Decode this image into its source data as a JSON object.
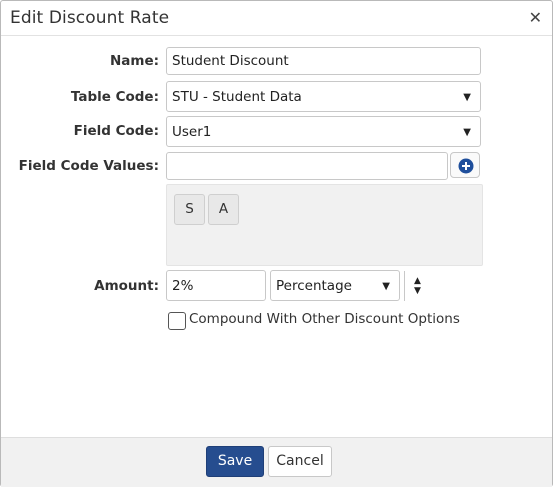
{
  "dialog": {
    "title": "Edit Discount Rate",
    "close_glyph": "✕"
  },
  "form": {
    "name": {
      "label": "Name:",
      "value": "Student Discount"
    },
    "table_code": {
      "label": "Table Code:",
      "value": "STU - Student Data"
    },
    "field_code": {
      "label": "Field Code:",
      "value": "User1"
    },
    "field_code_values": {
      "label": "Field Code Values:",
      "value": "",
      "chips": [
        "S",
        "A"
      ]
    },
    "amount": {
      "label": "Amount:",
      "value": "2%",
      "type": "Percentage"
    },
    "compound": {
      "label": "Compound With Other Discount Options",
      "checked": false
    }
  },
  "footer": {
    "save_label": "Save",
    "cancel_label": "Cancel"
  },
  "colors": {
    "primary_button": "#264d8f",
    "add_icon": "#1f4f9c"
  },
  "icons": {
    "add": "plus-circle-icon",
    "dropdown": "triangle-down-icon",
    "stepper": "up-down-arrows-icon",
    "close": "close-icon"
  }
}
